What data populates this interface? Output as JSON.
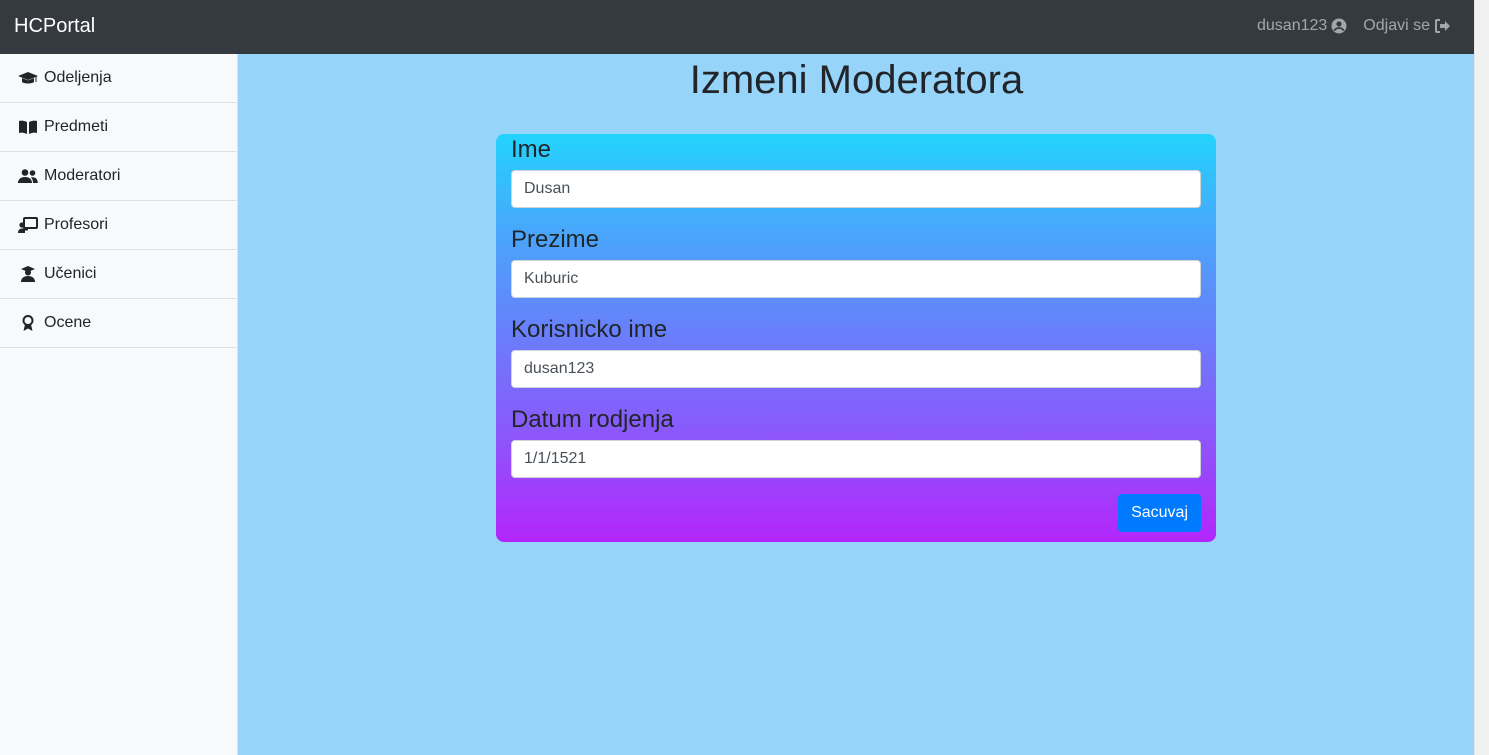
{
  "navbar": {
    "brand": "HCPortal",
    "username": "dusan123",
    "logout_label": "Odjavi se"
  },
  "sidebar": {
    "items": [
      {
        "label": "Odeljenja",
        "icon": "graduation-cap-icon"
      },
      {
        "label": "Predmeti",
        "icon": "book-icon"
      },
      {
        "label": "Moderatori",
        "icon": "users-icon"
      },
      {
        "label": "Profesori",
        "icon": "teacher-icon"
      },
      {
        "label": "Učenici",
        "icon": "student-icon"
      },
      {
        "label": "Ocene",
        "icon": "award-icon"
      }
    ]
  },
  "main": {
    "title": "Izmeni Moderatora",
    "form": {
      "fields": [
        {
          "label": "Ime",
          "value": "Dusan"
        },
        {
          "label": "Prezime",
          "value": "Kuburic"
        },
        {
          "label": "Korisnicko ime",
          "value": "dusan123"
        },
        {
          "label": "Datum rodjenja",
          "value": "1/1/1521"
        }
      ],
      "save_label": "Sacuvaj"
    }
  },
  "colors": {
    "navbar": "#343a40",
    "page_background": "#97d4fa",
    "gradient_top": "#22d3fc",
    "gradient_bottom": "#b326fb",
    "primary_button": "#007bff"
  }
}
